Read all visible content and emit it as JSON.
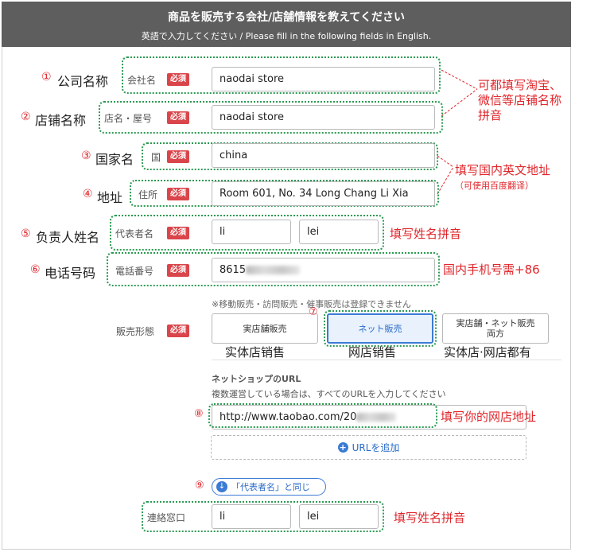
{
  "header": {
    "title": "商品を販売する会社/店舗情報を教えてください",
    "subtitle": "英語で入力してください / Please fill in the following fields in English."
  },
  "required_badge": "必須",
  "fields": {
    "company": {
      "annotation": "公司名称",
      "number": "①",
      "label": "会社名",
      "value": "naodai store"
    },
    "store": {
      "annotation": "店铺名称",
      "number": "②",
      "label": "店名・屋号",
      "value": "naodai store"
    },
    "country": {
      "annotation": "国家名",
      "number": "③",
      "label": "国",
      "value": "china"
    },
    "address": {
      "annotation": "地址",
      "number": "④",
      "label": "住所",
      "value": "Room 601, No. 34 Long Chang Li  Xia"
    },
    "representative": {
      "annotation": "负责人姓名",
      "number": "⑤",
      "label": "代表者名",
      "first": "li",
      "last": "lei"
    },
    "phone": {
      "annotation": "电话号码",
      "number": "⑥",
      "label": "電話番号",
      "value": "8615"
    },
    "contact": {
      "label": "連絡窓口",
      "first": "li",
      "last": "lei"
    }
  },
  "notes": {
    "store_name": "可都填写淘宝、\n微信等店铺名称\n拼音",
    "address": "填写国内英文地址",
    "address_hint": "（可使用百度翻译）",
    "name_pinyin": "填写姓名拼音",
    "phone": "国内手机号需+86",
    "url": "填写你的网店地址",
    "contact_pinyin": "填写姓名拼音"
  },
  "sales": {
    "notice": "※移動販売・訪問販売・催事販売は登録できません",
    "label": "販売形態",
    "marker": "⑦",
    "options": [
      {
        "label": "実店舗販売",
        "caption": "实体店销售"
      },
      {
        "label": "ネット販売",
        "caption": "网店销售"
      },
      {
        "label": "実店舗・ネット販売\n両方",
        "caption": "实体店·网店都有"
      }
    ]
  },
  "url": {
    "heading": "ネットショップのURL",
    "hint": "複数運営している場合は、すべてのURLを入力してください",
    "marker": "⑧",
    "value": "http://www.taobao.com/20",
    "add_label": "URLを追加"
  },
  "same_as": {
    "marker": "⑨",
    "label": "「代表者名」と同じ"
  },
  "colors": {
    "header_bg": "#5e5e5e",
    "required": "#d9454a",
    "annotation": "#e0262b",
    "accent": "#3b7bd5",
    "dotted": "#2b9a52"
  }
}
